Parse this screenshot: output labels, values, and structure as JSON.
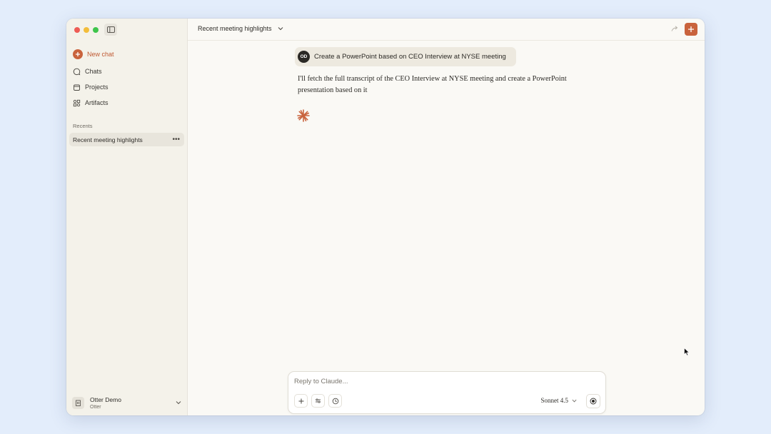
{
  "sidebar": {
    "new_chat": "New chat",
    "items": [
      {
        "label": "Chats",
        "icon": "chat-bubble-icon"
      },
      {
        "label": "Projects",
        "icon": "folder-icon"
      },
      {
        "label": "Artifacts",
        "icon": "shapes-icon"
      }
    ],
    "recents_label": "Recents",
    "recents": [
      {
        "label": "Recent meeting highlights"
      }
    ],
    "profile": {
      "name": "Otter Demo",
      "org": "Otter"
    }
  },
  "header": {
    "title": "Recent meeting highlights"
  },
  "conversation": {
    "user_initials": "OD",
    "user_message": "Create a PowerPoint based on CEO Interview at NYSE meeting",
    "assistant_message": "I'll fetch the full transcript of the CEO Interview at NYSE meeting and create a PowerPoint presentation based on it"
  },
  "composer": {
    "placeholder": "Reply to Claude...",
    "model": "Sonnet 4.5"
  },
  "colors": {
    "accent": "#c9633d",
    "sidebar_bg": "#f4f2ea",
    "main_bg": "#faf9f5",
    "desktop_bg": "#e3edfb"
  }
}
